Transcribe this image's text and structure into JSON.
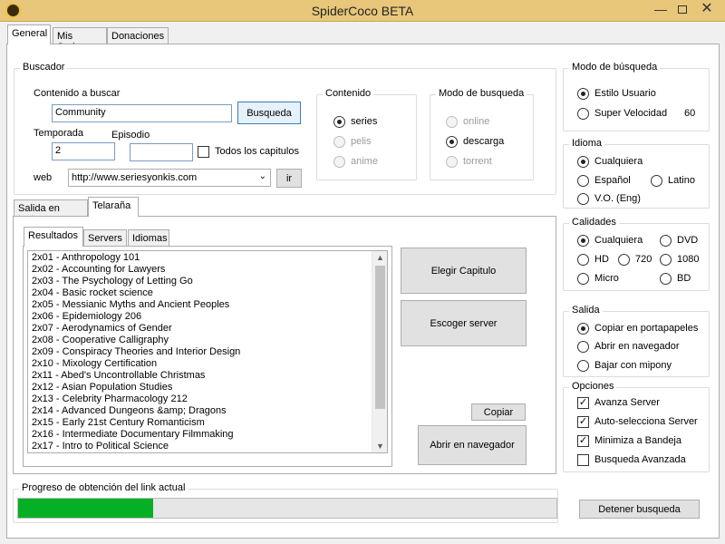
{
  "window": {
    "title": "SpiderCoco BETA",
    "minimize": "—",
    "close": "✕"
  },
  "main_tabs": [
    "General",
    "Mis Series",
    "Donaciones"
  ],
  "buscador": {
    "legend": "Buscador",
    "contenido_label": "Contenido a buscar",
    "contenido_value": "Community",
    "busqueda_button": "Busqueda",
    "temporada_label": "Temporada",
    "temporada_value": "2",
    "episodio_label": "Episodio",
    "episodio_value": "",
    "todos_label": "Todos los capitulos",
    "web_label": "web",
    "web_value": "http://www.seriesyonkis.com",
    "ir_button": "ir"
  },
  "contenido": {
    "legend": "Contenido",
    "options": [
      "series",
      "pelis",
      "anime"
    ]
  },
  "modo_busqueda": {
    "legend": "Modo de busqueda",
    "options": [
      "online",
      "descarga",
      "torrent"
    ]
  },
  "modo_de_busqueda_right": {
    "legend": "Modo de búsqueda",
    "options": [
      "Estilo Usuario",
      "Super Velocidad"
    ],
    "speed_value": "60"
  },
  "idioma": {
    "legend": "Idioma",
    "options": [
      "Cualquiera",
      "Español",
      "Latino",
      "V.O. (Eng)"
    ]
  },
  "calidades": {
    "legend": "Calidades",
    "options": [
      "Cualquiera",
      "DVD",
      "HD",
      "720",
      "1080",
      "Micro",
      "BD"
    ]
  },
  "salida": {
    "legend": "Salida",
    "options": [
      "Copiar en portapapeles",
      "Abrir en navegador",
      "Bajar con mipony"
    ]
  },
  "opciones": {
    "legend": "Opciones",
    "options": [
      "Avanza Server",
      "Auto-selecciona Server",
      "Minimiza a Bandeja",
      "Busqueda Avanzada"
    ],
    "checked": [
      true,
      true,
      true,
      false
    ]
  },
  "output_tabs": [
    "Salida en texto",
    "Telaraña"
  ],
  "result_tabs": [
    "Resultados",
    "Servers",
    "Idiomas"
  ],
  "results": [
    "2x01 - Anthropology 101",
    "2x02 - Accounting for Lawyers",
    "2x03 - The Psychology of Letting Go",
    "2x04 - Basic rocket science",
    "2x05 - Messianic Myths and Ancient Peoples",
    "2x06 - Epidemiology 206",
    "2x07 - Aerodynamics of Gender",
    "2x08 - Cooperative Calligraphy",
    "2x09 - Conspiracy Theories and Interior Design",
    "2x10 - Mixology Certification",
    "2x11 - Abed's Uncontrollable Christmas",
    "2x12 - Asian Population Studies",
    "2x13 - Celebrity Pharmacology 212",
    "2x14 - Advanced Dungeons &amp; Dragons",
    "2x15 - Early 21st Century Romanticism",
    "2x16 - Intermediate Documentary Filmmaking",
    "2x17 - Intro to Political Science"
  ],
  "actions": {
    "elegir": "Elegir Capitulo",
    "escoger": "Escoger server",
    "copiar": "Copiar",
    "abrir": "Abrir en navegador"
  },
  "progress": {
    "legend": "Progreso de obtención del link actual",
    "fraction": 0.25,
    "detener": "Detener busqueda"
  },
  "colors": {
    "progress_fill": "#06b025",
    "title_bar": "#e8c77a"
  }
}
